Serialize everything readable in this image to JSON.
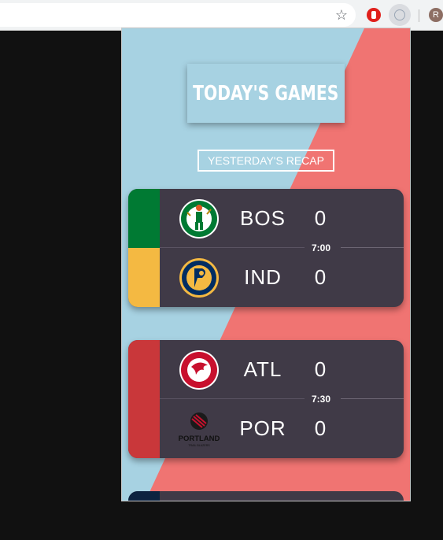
{
  "browser": {
    "avatar_initial": "R",
    "icons": [
      "star-icon",
      "stop-extension-icon",
      "basketball-extension-icon"
    ]
  },
  "popup": {
    "title": "TODAY'S GAMES",
    "recap_button": "YESTERDAY'S RECAP",
    "colors": {
      "light_blue": "#a7d2e2",
      "coral": "#f07472",
      "card": "#403a47"
    },
    "games": [
      {
        "time": "7:00",
        "home": {
          "abbr": "BOS",
          "score": "0",
          "color": "#007a33",
          "logo": "celtics-logo-icon"
        },
        "away": {
          "abbr": "IND",
          "score": "0",
          "color": "#f4b942",
          "logo": "pacers-logo-icon"
        }
      },
      {
        "time": "7:30",
        "home": {
          "abbr": "ATL",
          "score": "0",
          "color": "#c9373a",
          "logo": "hawks-logo-icon"
        },
        "away": {
          "abbr": "POR",
          "score": "0",
          "color": "#c9373a",
          "logo": "blazers-logo-icon",
          "logo_text": "PORTLAND",
          "logo_subtext": "TRAIL BLAZERS"
        }
      }
    ]
  }
}
